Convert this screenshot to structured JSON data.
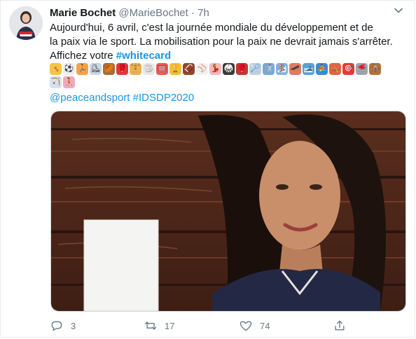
{
  "author": {
    "name": "Marie Bochet",
    "handle": "@MarieBochet",
    "separator": "·",
    "time": "7h"
  },
  "tweet": {
    "line1": "Aujourd'hui, 6 avril, c'est la journée mondiale du développement et de",
    "line2": "la paix via le sport. La mobilisation pour la paix ne devrait jamais s'arrêter.",
    "line3_prefix": "Affichez votre ",
    "hashtag_whitecard": "#whitecard",
    "mention": "@peaceandsport",
    "hashtag_idsdp": "#IDSDP2020"
  },
  "emojis_row1": [
    {
      "name": "trampoline-emoji",
      "color": "#f6c343",
      "glyph": "🤸"
    },
    {
      "name": "soccer-ball-emoji",
      "color": "#eeeeee",
      "glyph": "⚽"
    },
    {
      "name": "running-emoji",
      "color": "#f4a04a",
      "glyph": "🏃"
    },
    {
      "name": "ice-skate-emoji",
      "color": "#c9d6e3",
      "glyph": "⛸"
    },
    {
      "name": "rugby-ball-emoji",
      "color": "#a86b3c",
      "glyph": "🏉"
    },
    {
      "name": "boxing-glove-emoji",
      "color": "#d93b3b",
      "glyph": "🥊"
    },
    {
      "name": "weightlifting-emoji",
      "color": "#f0b04c",
      "glyph": "🏋"
    },
    {
      "name": "volleyball-emoji",
      "color": "#e8e8e8",
      "glyph": "🏐"
    },
    {
      "name": "goal-net-emoji",
      "color": "#e85a5a",
      "glyph": "🥅"
    },
    {
      "name": "trophy-emoji",
      "color": "#f1c232",
      "glyph": "🏆"
    },
    {
      "name": "american-football-emoji",
      "color": "#8b4a2b",
      "glyph": "🏈"
    },
    {
      "name": "baseball-emoji",
      "color": "#f2f2f2",
      "glyph": "⚾"
    },
    {
      "name": "dancer-emoji",
      "color": "#f4b6c2",
      "glyph": "💃"
    },
    {
      "name": "martial-arts-emoji",
      "color": "#3a3a3a",
      "glyph": "🥋"
    },
    {
      "name": "boxing-glove-2-emoji",
      "color": "#c0392b",
      "glyph": "🥊"
    },
    {
      "name": "badminton-emoji",
      "color": "#bfcde0",
      "glyph": "🏸"
    },
    {
      "name": "fencing-emoji",
      "color": "#7aa7d6",
      "glyph": "🤺"
    },
    {
      "name": "snowboard-emoji",
      "color": "#7fb3e6",
      "glyph": "🏂"
    },
    {
      "name": "skateboard-emoji",
      "color": "#e07a5f",
      "glyph": "🛹"
    },
    {
      "name": "ski-emoji",
      "color": "#5aa0d8",
      "glyph": "🎿"
    },
    {
      "name": "rowing-emoji",
      "color": "#3f8bd0",
      "glyph": "🚣"
    },
    {
      "name": "canoe-emoji",
      "color": "#e0663f",
      "glyph": "🛶"
    },
    {
      "name": "target-emoji",
      "color": "#e33b3b",
      "glyph": "🎯"
    },
    {
      "name": "curling-stone-emoji",
      "color": "#9aa5b1",
      "glyph": "🥌"
    },
    {
      "name": "horse-racing-emoji",
      "color": "#b0723f",
      "glyph": "🏇"
    }
  ],
  "emojis_row2": [
    {
      "name": "archery-emoji",
      "color": "#d9e2ec",
      "glyph": "🏹"
    },
    {
      "name": "gymnast-emoji",
      "color": "#f1a7c0",
      "glyph": "🤾"
    }
  ],
  "actions": {
    "reply_count": "3",
    "retweet_count": "17",
    "like_count": "74"
  }
}
